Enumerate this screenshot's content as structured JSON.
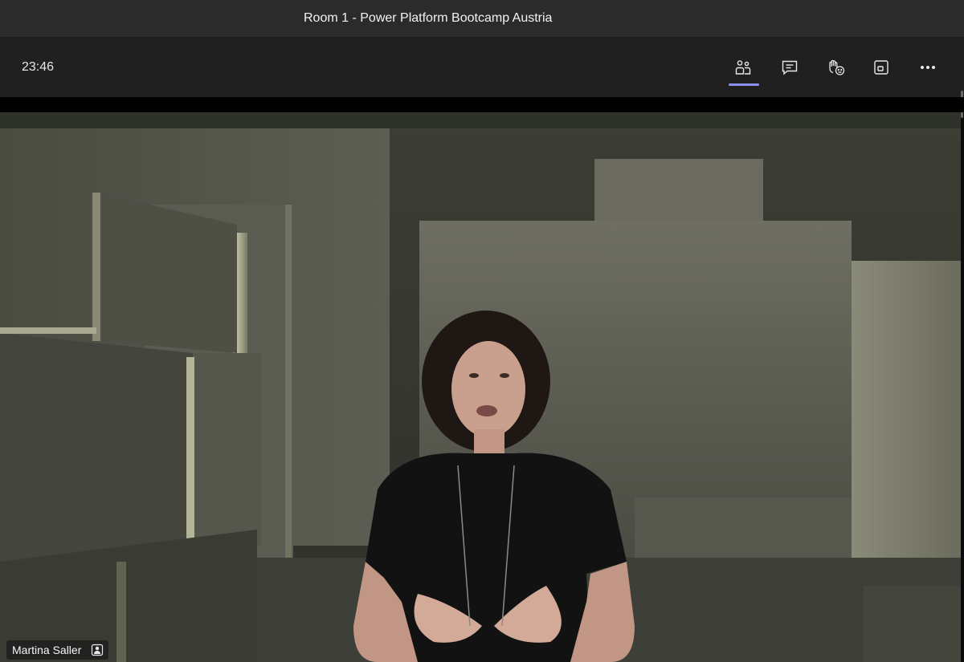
{
  "window": {
    "title": "Room 1 - Power Platform Bootcamp Austria"
  },
  "toolbar": {
    "timer": "23:46",
    "buttons": [
      {
        "name": "people",
        "icon": "people-icon",
        "active": true
      },
      {
        "name": "chat",
        "icon": "chat-icon"
      },
      {
        "name": "reactions",
        "icon": "raise-hand-reactions-icon"
      },
      {
        "name": "view",
        "icon": "view-layout-icon"
      },
      {
        "name": "more",
        "icon": "more-actions-icon"
      }
    ],
    "accent": "#8b8ff0"
  },
  "participant": {
    "name": "Martina Saller",
    "badge_icon": "presenter-icon"
  },
  "colors": {
    "titlebar_bg": "#2b2b2b",
    "toolbar_bg": "#202020",
    "video_bg": "#3a3c33"
  }
}
